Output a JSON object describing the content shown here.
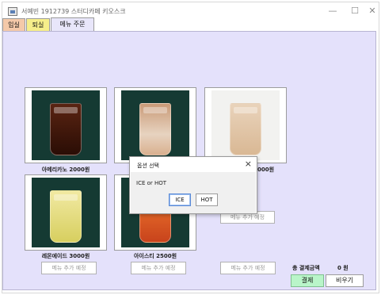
{
  "window": {
    "title": "서예빈 1912739 스터디카페 키오스크",
    "controls": {
      "minimize": "—",
      "maximize": "☐",
      "close": "✕"
    }
  },
  "tabs": [
    {
      "label": "입실"
    },
    {
      "label": "퇴실"
    },
    {
      "label": "메뉴 주문"
    }
  ],
  "menu_items": [
    {
      "name": "아메리카노 2000원",
      "image": "iced-americano"
    },
    {
      "name": "",
      "image": "iced-latte"
    },
    {
      "name": "",
      "image": "milk-tea"
    },
    {
      "name": "레몬에이드 3000원",
      "image": "lemonade"
    },
    {
      "name": "아이스티 2500원",
      "image": "iced-tea"
    }
  ],
  "partial_name": "000원",
  "placeholder_buttons": [
    {
      "label": "메뉴 추가 예정"
    },
    {
      "label": "메뉴 추가 예정"
    },
    {
      "label": "메뉴 추가 예정"
    },
    {
      "label": "메뉴 추가 예정"
    }
  ],
  "order": {
    "total_label": "총 결제금액",
    "total_value": "0 원",
    "pay_label": "결제",
    "clear_label": "비우기"
  },
  "dialog": {
    "title": "옵션 선택",
    "message": "ICE or HOT",
    "ice_label": "ICE",
    "hot_label": "HOT"
  },
  "colors": {
    "panel_bg": "#e4e1fb",
    "tab_in": "#f4c9a9",
    "tab_out": "#f6ee8a",
    "pay_button": "#b9f5c9"
  }
}
